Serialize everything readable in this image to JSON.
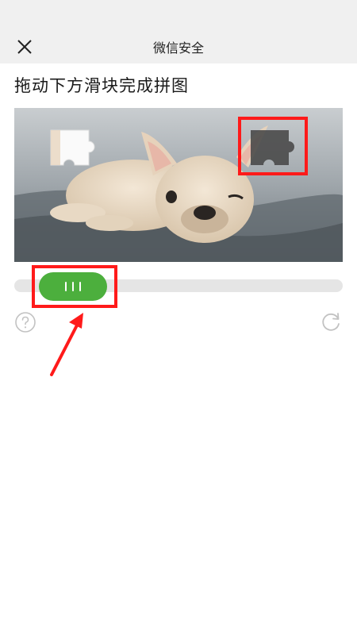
{
  "header": {
    "title": "微信安全",
    "close_icon": "close-icon",
    "background": "#f0f0f0"
  },
  "captcha": {
    "instruction": "拖动下方滑块完成拼图",
    "slider_progress": 0.08,
    "accent_color": "#4caf3d",
    "help_icon": "question-circle-icon",
    "refresh_icon": "refresh-icon"
  },
  "annotations": {
    "highlight_color": "#ff1a1a",
    "arrow_icon": "red-arrow-icon"
  }
}
